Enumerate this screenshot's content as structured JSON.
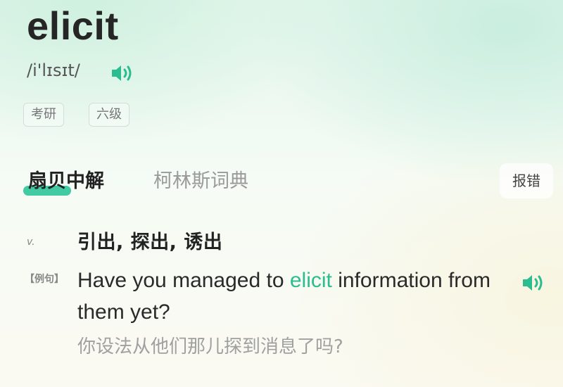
{
  "word": "elicit",
  "phonetic": "/i'lɪsɪt/",
  "tags": [
    "考研",
    "六级"
  ],
  "tabs": [
    {
      "label": "扇贝中解",
      "active": true
    },
    {
      "label": "柯林斯词典",
      "active": false
    }
  ],
  "report_label": "报错",
  "entry": {
    "part_of_speech": "v.",
    "definition": "引出, 探出, 诱出"
  },
  "example": {
    "label": "【例句】",
    "before": "Have you managed to ",
    "highlight": "elicit",
    "after": " information from them yet?",
    "translation": "你设法从他们那儿探到消息了吗?"
  },
  "icons": {
    "pronounce": "speaker-icon",
    "example_audio": "speaker-icon"
  },
  "colors": {
    "accent": "#2bbd8f",
    "text": "#262626",
    "muted": "#a0a0a0"
  }
}
